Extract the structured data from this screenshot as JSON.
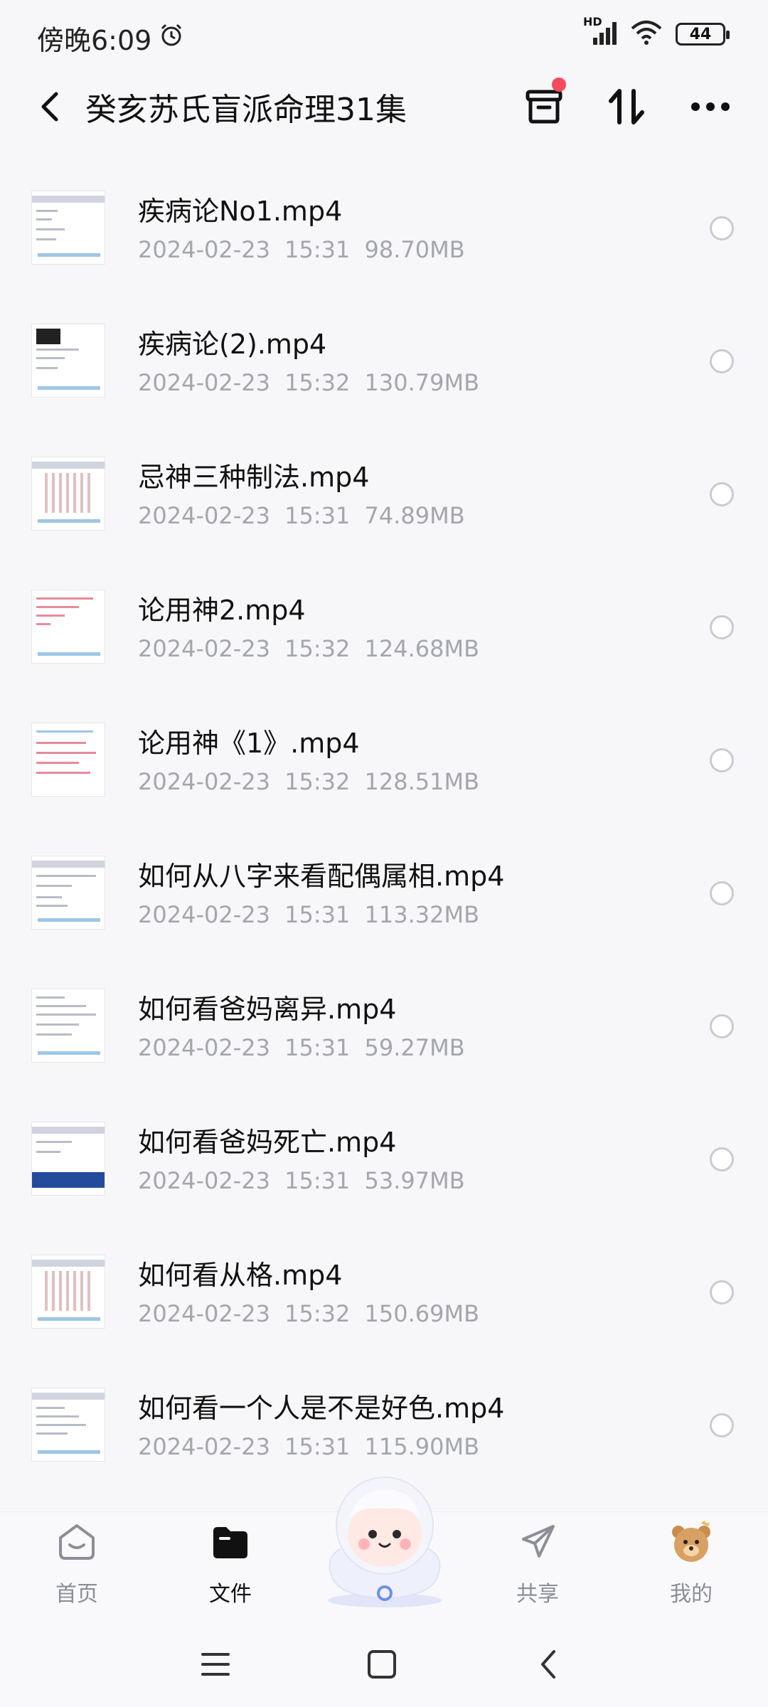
{
  "status_bar": {
    "time": "傍晚6:09",
    "network_label": "HD",
    "battery": "44"
  },
  "header": {
    "title": "癸亥苏氏盲派命理31集"
  },
  "files": [
    {
      "name": "疾病论No1.mp4",
      "date": "2024-02-23",
      "time": "15:31",
      "size": "98.70MB"
    },
    {
      "name": "疾病论(2).mp4",
      "date": "2024-02-23",
      "time": "15:32",
      "size": "130.79MB"
    },
    {
      "name": "忌神三种制法.mp4",
      "date": "2024-02-23",
      "time": "15:31",
      "size": "74.89MB"
    },
    {
      "name": "论用神2.mp4",
      "date": "2024-02-23",
      "time": "15:32",
      "size": "124.68MB"
    },
    {
      "name": "论用神《1》.mp4",
      "date": "2024-02-23",
      "time": "15:32",
      "size": "128.51MB"
    },
    {
      "name": "如何从八字来看配偶属相.mp4",
      "date": "2024-02-23",
      "time": "15:31",
      "size": "113.32MB"
    },
    {
      "name": "如何看爸妈离异.mp4",
      "date": "2024-02-23",
      "time": "15:31",
      "size": "59.27MB"
    },
    {
      "name": "如何看爸妈死亡.mp4",
      "date": "2024-02-23",
      "time": "15:31",
      "size": "53.97MB"
    },
    {
      "name": "如何看从格.mp4",
      "date": "2024-02-23",
      "time": "15:32",
      "size": "150.69MB"
    },
    {
      "name": "如何看一个人是不是好色.mp4",
      "date": "2024-02-23",
      "time": "15:31",
      "size": "115.90MB"
    }
  ],
  "bottom_nav": {
    "home": "首页",
    "files": "文件",
    "share": "共享",
    "mine": "我的"
  },
  "colors": {
    "accent_red": "#f54a5e",
    "meta_gray": "#a4a6ad"
  }
}
